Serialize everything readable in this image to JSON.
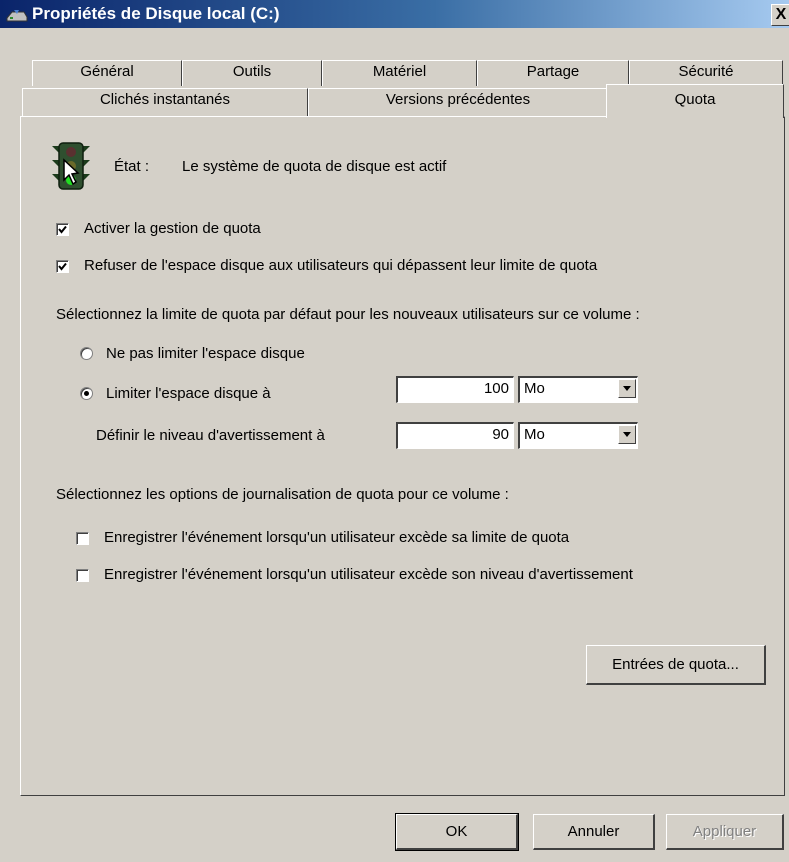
{
  "window": {
    "title": "Propriétés de Disque local (C:)",
    "close_label": "X"
  },
  "tabs": {
    "row1": [
      "Général",
      "Outils",
      "Matériel",
      "Partage",
      "Sécurité"
    ],
    "row2": [
      "Clichés instantanés",
      "Versions précédentes",
      "Quota"
    ],
    "active": "Quota"
  },
  "status": {
    "label": "État :",
    "text": "Le système de quota de disque est actif",
    "icon": "traffic-light-icon"
  },
  "options": {
    "enable_quota": {
      "label": "Activer la gestion de quota",
      "checked": true
    },
    "deny_space": {
      "label": "Refuser de l'espace disque aux utilisateurs qui dépassent leur limite de quota",
      "checked": true
    }
  },
  "default_limit": {
    "heading": "Sélectionnez la limite de quota par défaut pour les nouveaux utilisateurs sur ce volume :",
    "no_limit_label": "Ne pas limiter l'espace disque",
    "limit_label": "Limiter l'espace disque à",
    "selected": "limit",
    "limit_value": "100",
    "limit_unit": "Mo",
    "warning_label": "Définir le niveau d'avertissement à",
    "warning_value": "90",
    "warning_unit": "Mo"
  },
  "logging": {
    "heading": "Sélectionnez les options de journalisation de quota pour ce volume :",
    "log_limit": {
      "label": "Enregistrer l'événement lorsqu'un utilisateur excède sa limite de quota",
      "checked": false
    },
    "log_warning": {
      "label": "Enregistrer l'événement lorsqu'un utilisateur excède son niveau d'avertissement",
      "checked": false
    }
  },
  "buttons": {
    "quota_entries": "Entrées de quota...",
    "ok": "OK",
    "cancel": "Annuler",
    "apply": "Appliquer"
  },
  "colors": {
    "titlebar_start": "#0a246a",
    "titlebar_end": "#a6caf0",
    "dialog_bg": "#d4d0c8"
  }
}
